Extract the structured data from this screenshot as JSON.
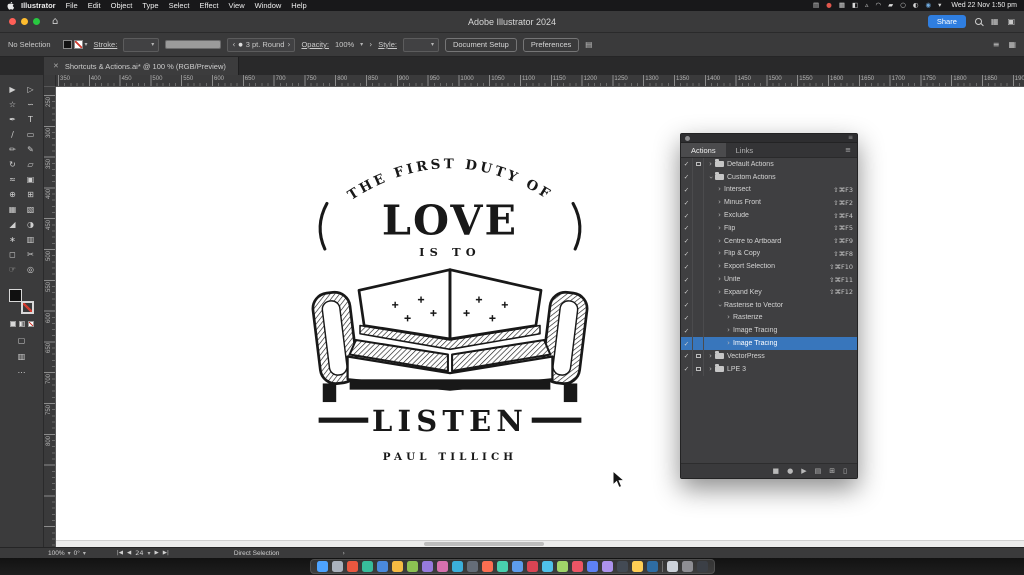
{
  "menubar": {
    "items": [
      "Illustrator",
      "File",
      "Edit",
      "Object",
      "Type",
      "Select",
      "Effect",
      "View",
      "Window",
      "Help"
    ],
    "tray_icons": [
      {
        "name": "window-manager-icon",
        "glyph": "▤",
        "color": "#d9d9d9"
      },
      {
        "name": "record-dot-icon",
        "glyph": "●",
        "color": "#e0564c"
      },
      {
        "name": "display-icon",
        "glyph": "▦",
        "color": "#d9d9d9"
      },
      {
        "name": "sidecar-icon",
        "glyph": "◧",
        "color": "#d9d9d9"
      },
      {
        "name": "bluetooth-icon",
        "glyph": "▵",
        "color": "#d9d9d9"
      },
      {
        "name": "wifi-icon",
        "glyph": "◠",
        "color": "#d9d9d9"
      },
      {
        "name": "battery-icon",
        "glyph": "▰",
        "color": "#d9d9d9"
      },
      {
        "name": "search-icon",
        "glyph": "○",
        "color": "#d9d9d9"
      },
      {
        "name": "control-center-icon",
        "glyph": "◐",
        "color": "#d9d9d9"
      },
      {
        "name": "siri-icon",
        "glyph": "◉",
        "color": "#6fa8dc"
      },
      {
        "name": "dropdown-icon",
        "glyph": "▾",
        "color": "#d9d9d9"
      }
    ],
    "clock": "Wed 22 Nov 1:50 pm"
  },
  "titlebar": {
    "title": "Adobe Illustrator 2024",
    "share_label": "Share"
  },
  "controlbar": {
    "selection_label": "No Selection",
    "stroke_label": "Stroke:",
    "brush_value": "3 pt. Round",
    "opacity_label": "Opacity:",
    "opacity_value": "100%",
    "style_label": "Style:",
    "document_setup_label": "Document Setup",
    "preferences_label": "Preferences"
  },
  "tabbar": {
    "doc_title": "Shortcuts & Actions.ai* @ 100 % (RGB/Preview)"
  },
  "rulers": {
    "horizontal": [
      "350",
      "400",
      "450",
      "500",
      "550",
      "600",
      "650",
      "700",
      "750",
      "800",
      "850",
      "900",
      "950",
      "1000",
      "1050",
      "1100",
      "1150",
      "1200",
      "1250",
      "1300",
      "1350",
      "1400",
      "1450",
      "1500",
      "1550",
      "1600",
      "1650",
      "1700",
      "1750",
      "1800",
      "1850",
      "1900"
    ],
    "vertical": [
      "250",
      "300",
      "350",
      "400",
      "450",
      "500",
      "550",
      "600",
      "650",
      "700",
      "750",
      "800"
    ]
  },
  "toolbar_tools": [
    {
      "name": "selection-tool",
      "glyph": "▶"
    },
    {
      "name": "direct-selection-tool",
      "glyph": "▷"
    },
    {
      "name": "magic-wand-tool",
      "glyph": "☆"
    },
    {
      "name": "lasso-tool",
      "glyph": "∽"
    },
    {
      "name": "pen-tool",
      "glyph": "✒"
    },
    {
      "name": "type-tool",
      "glyph": "T"
    },
    {
      "name": "line-segment-tool",
      "glyph": "∕"
    },
    {
      "name": "rectangle-tool",
      "glyph": "▭"
    },
    {
      "name": "paintbrush-tool",
      "glyph": "✏"
    },
    {
      "name": "pencil-tool",
      "glyph": "✎"
    },
    {
      "name": "rotate-tool",
      "glyph": "↻"
    },
    {
      "name": "scale-tool",
      "glyph": "▱"
    },
    {
      "name": "width-tool",
      "glyph": "≈"
    },
    {
      "name": "free-transform-tool",
      "glyph": "▣"
    },
    {
      "name": "shape-builder-tool",
      "glyph": "⊕"
    },
    {
      "name": "perspective-grid-tool",
      "glyph": "⊞"
    },
    {
      "name": "mesh-tool",
      "glyph": "▦"
    },
    {
      "name": "gradient-tool",
      "glyph": "▧"
    },
    {
      "name": "eyedropper-tool",
      "glyph": "◢"
    },
    {
      "name": "blend-tool",
      "glyph": "◑"
    },
    {
      "name": "symbol-sprayer-tool",
      "glyph": "∗"
    },
    {
      "name": "graph-tool",
      "glyph": "▥"
    },
    {
      "name": "artboard-tool",
      "glyph": "◻"
    },
    {
      "name": "slice-tool",
      "glyph": "✂"
    },
    {
      "name": "hand-tool",
      "glyph": "☞"
    },
    {
      "name": "zoom-tool",
      "glyph": "◎"
    }
  ],
  "logo": {
    "arc_text": "THE FIRST DUTY OF",
    "word_love": "LOVE",
    "word_is_to": "IS TO",
    "word_listen": "LISTEN",
    "author": "PAUL TILLICH",
    "ink_color": "#181818"
  },
  "actions_panel": {
    "tabs": [
      "Actions",
      "Links"
    ],
    "selected_color": "#3876bc",
    "rows": [
      {
        "check": true,
        "dialog": true,
        "chevron": "right",
        "folder": true,
        "indent": 0,
        "label": "Default Actions",
        "shortcut": ""
      },
      {
        "check": true,
        "dialog": false,
        "chevron": "down",
        "folder": true,
        "indent": 0,
        "label": "Custom Actions",
        "shortcut": ""
      },
      {
        "check": true,
        "dialog": false,
        "chevron": "right",
        "folder": false,
        "indent": 1,
        "label": "Intersect",
        "shortcut": "⇧⌘F3"
      },
      {
        "check": true,
        "dialog": false,
        "chevron": "right",
        "folder": false,
        "indent": 1,
        "label": "Minus Front",
        "shortcut": "⇧⌘F2"
      },
      {
        "check": true,
        "dialog": false,
        "chevron": "right",
        "folder": false,
        "indent": 1,
        "label": "Exclude",
        "shortcut": "⇧⌘F4"
      },
      {
        "check": true,
        "dialog": false,
        "chevron": "right",
        "folder": false,
        "indent": 1,
        "label": "Flip",
        "shortcut": "⇧⌘F5"
      },
      {
        "check": true,
        "dialog": false,
        "chevron": "right",
        "folder": false,
        "indent": 1,
        "label": "Centre to Artboard",
        "shortcut": "⇧⌘F9"
      },
      {
        "check": true,
        "dialog": false,
        "chevron": "right",
        "folder": false,
        "indent": 1,
        "label": "Flip & Copy",
        "shortcut": "⇧⌘F8"
      },
      {
        "check": true,
        "dialog": false,
        "chevron": "right",
        "folder": false,
        "indent": 1,
        "label": "Export Selection",
        "shortcut": "⇧⌘F10"
      },
      {
        "check": true,
        "dialog": false,
        "chevron": "right",
        "folder": false,
        "indent": 1,
        "label": "Unite",
        "shortcut": "⇧⌘F11"
      },
      {
        "check": true,
        "dialog": false,
        "chevron": "right",
        "folder": false,
        "indent": 1,
        "label": "Expand Key",
        "shortcut": "⇧⌘F12"
      },
      {
        "check": true,
        "dialog": false,
        "chevron": "down",
        "folder": false,
        "indent": 1,
        "label": "Rasterise to Vector",
        "shortcut": ""
      },
      {
        "check": true,
        "dialog": false,
        "chevron": "right",
        "folder": false,
        "indent": 2,
        "label": "Rasterize",
        "shortcut": ""
      },
      {
        "check": true,
        "dialog": false,
        "chevron": "right",
        "folder": false,
        "indent": 2,
        "label": "Image Tracing",
        "shortcut": ""
      },
      {
        "check": true,
        "dialog": false,
        "chevron": "right",
        "folder": false,
        "indent": 2,
        "label": "Image Tracing",
        "shortcut": "",
        "selected": true
      },
      {
        "check": true,
        "dialog": true,
        "chevron": "right",
        "folder": true,
        "indent": 0,
        "label": "VectorPress",
        "shortcut": ""
      },
      {
        "check": true,
        "dialog": true,
        "chevron": "right",
        "folder": true,
        "indent": 0,
        "label": "LPE 3",
        "shortcut": ""
      }
    ],
    "footer_icons": [
      {
        "name": "stop-icon",
        "glyph": "■"
      },
      {
        "name": "record-icon",
        "glyph": "●"
      },
      {
        "name": "play-icon",
        "glyph": "▶"
      },
      {
        "name": "new-set-icon",
        "glyph": "▤"
      },
      {
        "name": "new-action-icon",
        "glyph": "⊞"
      },
      {
        "name": "delete-icon",
        "glyph": "▯"
      }
    ]
  },
  "statusbar": {
    "zoom": "100%",
    "rotation": "0°",
    "artboard_number": "24",
    "tool_name": "Direct Selection"
  },
  "icons": {
    "caret": "▾",
    "stepper_left": "‹",
    "stepper_right": "›",
    "brush_dot": "●",
    "angle": "›",
    "align": "▤",
    "menu": "≡",
    "grid": "▦",
    "home": "⌂",
    "workspace": "▦",
    "panels": "▣",
    "hamburger": "≡",
    "chevron": "›",
    "check": "✓",
    "close": "✕",
    "nav_first": "|◀",
    "nav_prev": "◀",
    "nav_next": "▶",
    "nav_last": "▶|"
  },
  "dock_colors": [
    "#4da3ff",
    "#aab2bd",
    "#e9573f",
    "#37bc9b",
    "#4a89dc",
    "#f6bb42",
    "#8cc152",
    "#967adc",
    "#d770ad",
    "#3bafda",
    "#656d78",
    "#fc6e51",
    "#48cfad",
    "#5d9cec",
    "#da4453",
    "#4fc1e9",
    "#a0d468",
    "#ed5565",
    "#5e81f4",
    "#ac92ec",
    "#434a54",
    "#ffce54",
    "#2e6da4",
    "#ccd1d9",
    "#8e8e93",
    "#3b3f46"
  ]
}
